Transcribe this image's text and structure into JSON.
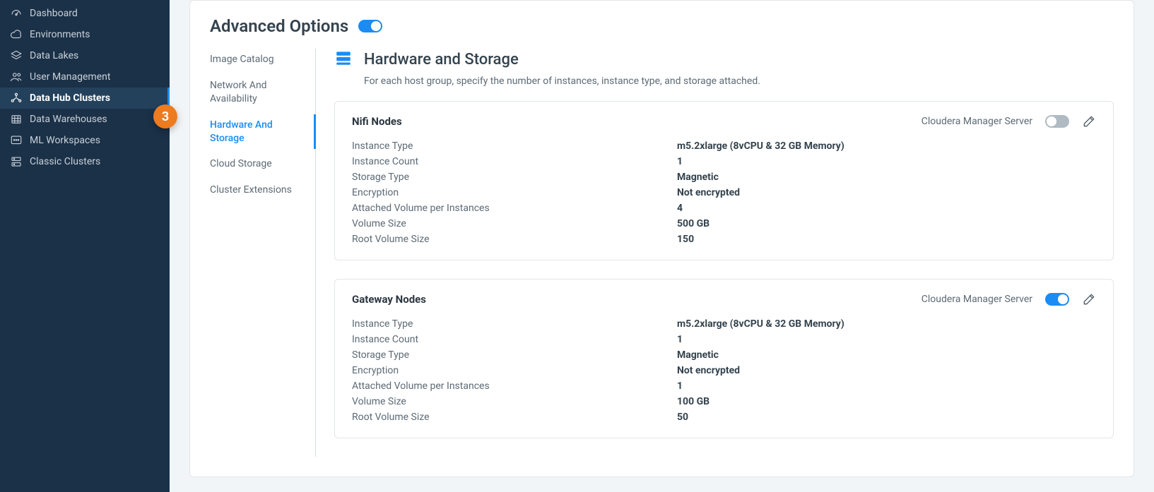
{
  "callout": "3",
  "sidebar": {
    "items": [
      {
        "label": "Dashboard",
        "icon": "gauge"
      },
      {
        "label": "Environments",
        "icon": "cloud"
      },
      {
        "label": "Data Lakes",
        "icon": "layers"
      },
      {
        "label": "User Management",
        "icon": "users"
      },
      {
        "label": "Data Hub Clusters",
        "icon": "cluster",
        "active": true
      },
      {
        "label": "Data Warehouses",
        "icon": "warehouse"
      },
      {
        "label": "ML Workspaces",
        "icon": "ml"
      },
      {
        "label": "Classic Clusters",
        "icon": "classic"
      }
    ]
  },
  "page": {
    "advanced_options_label": "Advanced Options",
    "advanced_options_on": true
  },
  "subnav": {
    "items": [
      {
        "label": "Image Catalog"
      },
      {
        "label": "Network And Availability"
      },
      {
        "label": "Hardware And Storage",
        "active": true
      },
      {
        "label": "Cloud Storage"
      },
      {
        "label": "Cluster Extensions"
      }
    ]
  },
  "section": {
    "title": "Hardware and Storage",
    "subtitle": "For each host group, specify the number of instances, instance type, and storage attached."
  },
  "cards": [
    {
      "title": "Nifi Nodes",
      "cms_label": "Cloudera Manager Server",
      "cms_on": false,
      "rows": [
        {
          "k": "Instance Type",
          "v": "m5.2xlarge (8vCPU & 32 GB Memory)"
        },
        {
          "k": "Instance Count",
          "v": "1"
        },
        {
          "k": "Storage Type",
          "v": "Magnetic"
        },
        {
          "k": "Encryption",
          "v": "Not encrypted"
        },
        {
          "k": "Attached Volume per Instances",
          "v": "4"
        },
        {
          "k": "Volume Size",
          "v": "500 GB"
        },
        {
          "k": "Root Volume Size",
          "v": "150"
        }
      ]
    },
    {
      "title": "Gateway Nodes",
      "cms_label": "Cloudera Manager Server",
      "cms_on": true,
      "rows": [
        {
          "k": "Instance Type",
          "v": "m5.2xlarge (8vCPU & 32 GB Memory)"
        },
        {
          "k": "Instance Count",
          "v": "1"
        },
        {
          "k": "Storage Type",
          "v": "Magnetic"
        },
        {
          "k": "Encryption",
          "v": "Not encrypted"
        },
        {
          "k": "Attached Volume per Instances",
          "v": "1"
        },
        {
          "k": "Volume Size",
          "v": "100 GB"
        },
        {
          "k": "Root Volume Size",
          "v": "50"
        }
      ]
    }
  ]
}
